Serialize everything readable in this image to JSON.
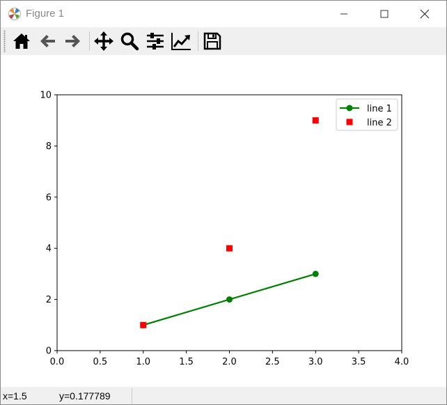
{
  "window": {
    "title": "Figure 1"
  },
  "toolbar": {
    "buttons": [
      {
        "icon": "home-icon",
        "name": "home-button"
      },
      {
        "icon": "back-arrow-icon",
        "name": "back-button"
      },
      {
        "icon": "forward-arrow-icon",
        "name": "forward-button"
      },
      {
        "icon": "pan-icon",
        "name": "pan-button"
      },
      {
        "icon": "zoom-icon",
        "name": "zoom-button"
      },
      {
        "icon": "subplots-icon",
        "name": "configure-subplots-button"
      },
      {
        "icon": "edit-axis-icon",
        "name": "edit-axis-button"
      },
      {
        "icon": "save-icon",
        "name": "save-button"
      }
    ]
  },
  "status": {
    "x_readout": "x=1.5",
    "y_readout": "y=0.177789"
  },
  "chart_data": {
    "type": "line",
    "xlim": [
      0,
      4
    ],
    "ylim": [
      0,
      10
    ],
    "xticks": [
      "0.0",
      "0.5",
      "1.0",
      "1.5",
      "2.0",
      "2.5",
      "3.0",
      "3.5",
      "4.0"
    ],
    "yticks": [
      "0",
      "2",
      "4",
      "6",
      "8",
      "10"
    ],
    "grid": false,
    "legend_position": "top-right",
    "series": [
      {
        "name": "line 1",
        "x": [
          1,
          2,
          3
        ],
        "y": [
          1,
          2,
          3
        ],
        "color": "#008000",
        "marker": "circle",
        "line": true
      },
      {
        "name": "line 2",
        "x": [
          1,
          2,
          3
        ],
        "y": [
          1,
          4,
          9
        ],
        "color": "#ff0000",
        "marker": "square",
        "line": false
      }
    ]
  }
}
